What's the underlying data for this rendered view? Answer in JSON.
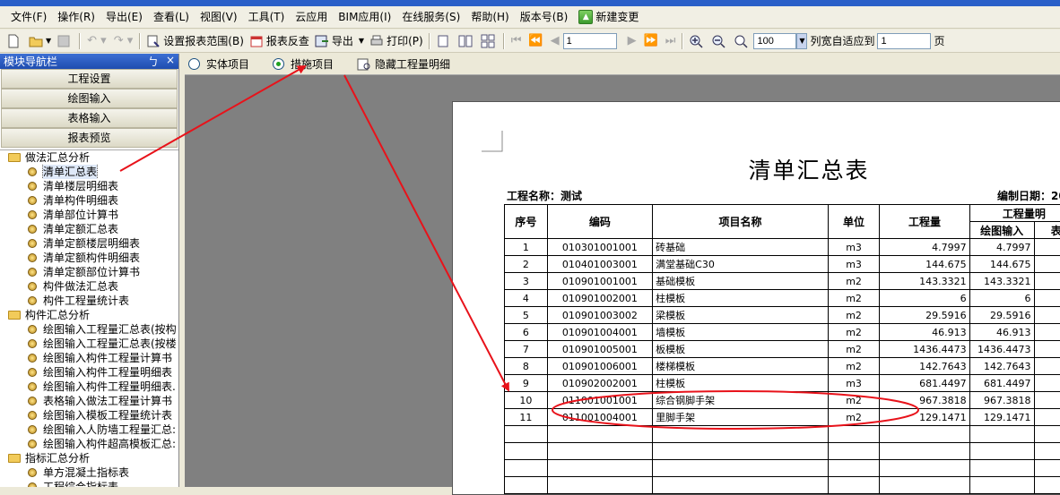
{
  "menu": [
    "文件(F)",
    "操作(R)",
    "导出(E)",
    "查看(L)",
    "视图(V)",
    "工具(T)",
    "云应用",
    "BIM应用(I)",
    "在线服务(S)",
    "帮助(H)",
    "版本号(B)"
  ],
  "menu_extra": "新建变更",
  "toolbar": {
    "set_range": "设置报表范围(B)",
    "check": "报表反查",
    "export": "导出",
    "print": "打印(P)",
    "page": "1",
    "zoom": "100",
    "fit": "列宽自适应到",
    "fit_value": "1",
    "fit_unit": "页"
  },
  "nav": {
    "title": "模块导航栏",
    "pin": "ㄅ",
    "close": "×",
    "buttons": [
      "工程设置",
      "绘图输入",
      "表格输入",
      "报表预览"
    ],
    "tree": [
      {
        "type": "folder",
        "label": "做法汇总分析"
      },
      {
        "type": "leaf",
        "label": "清单汇总表",
        "selected": true
      },
      {
        "type": "leaf",
        "label": "清单楼层明细表"
      },
      {
        "type": "leaf",
        "label": "清单构件明细表"
      },
      {
        "type": "leaf",
        "label": "清单部位计算书"
      },
      {
        "type": "leaf",
        "label": "清单定额汇总表"
      },
      {
        "type": "leaf",
        "label": "清单定额楼层明细表"
      },
      {
        "type": "leaf",
        "label": "清单定额构件明细表"
      },
      {
        "type": "leaf",
        "label": "清单定额部位计算书"
      },
      {
        "type": "leaf",
        "label": "构件做法汇总表"
      },
      {
        "type": "leaf",
        "label": "构件工程量统计表"
      },
      {
        "type": "folder",
        "label": "构件汇总分析"
      },
      {
        "type": "leaf",
        "label": "绘图输入工程量汇总表(按构"
      },
      {
        "type": "leaf",
        "label": "绘图输入工程量汇总表(按楼"
      },
      {
        "type": "leaf",
        "label": "绘图输入构件工程量计算书"
      },
      {
        "type": "leaf",
        "label": "绘图输入构件工程量明细表"
      },
      {
        "type": "leaf",
        "label": "绘图输入构件工程量明细表."
      },
      {
        "type": "leaf",
        "label": "表格输入做法工程量计算书"
      },
      {
        "type": "leaf",
        "label": "绘图输入模板工程量统计表"
      },
      {
        "type": "leaf",
        "label": "绘图输入人防墙工程量汇总:"
      },
      {
        "type": "leaf",
        "label": "绘图输入构件超高模板汇总:"
      },
      {
        "type": "folder",
        "label": "指标汇总分析"
      },
      {
        "type": "leaf",
        "label": "单方混凝土指标表"
      },
      {
        "type": "leaf",
        "label": "工程综合指标表"
      }
    ]
  },
  "radio": [
    {
      "label": "实体项目",
      "checked": false
    },
    {
      "label": "措施项目",
      "checked": true
    },
    {
      "label": "隐藏工程量明细",
      "checked": false
    }
  ],
  "report": {
    "title": "清单汇总表",
    "project": "工程名称：测试",
    "date": "编制日期：20",
    "headers": [
      "序号",
      "编码",
      "项目名称",
      "单位",
      "工程量",
      "工程量明",
      "绘图输入",
      "表"
    ],
    "rows": [
      [
        "1",
        "010301001001",
        "砖基础",
        "m3",
        "4.7997",
        "4.7997"
      ],
      [
        "2",
        "010401003001",
        "满堂基础C30",
        "m3",
        "144.675",
        "144.675"
      ],
      [
        "3",
        "010901001001",
        "基础模板",
        "m2",
        "143.3321",
        "143.3321"
      ],
      [
        "4",
        "010901002001",
        "柱模板",
        "m2",
        "6",
        "6"
      ],
      [
        "5",
        "010901003002",
        "梁模板",
        "m2",
        "29.5916",
        "29.5916"
      ],
      [
        "6",
        "010901004001",
        "墙模板",
        "m2",
        "46.913",
        "46.913"
      ],
      [
        "7",
        "010901005001",
        "板模板",
        "m2",
        "1436.4473",
        "1436.4473"
      ],
      [
        "8",
        "010901006001",
        "楼梯模板",
        "m2",
        "142.7643",
        "142.7643"
      ],
      [
        "9",
        "010902002001",
        "柱模板",
        "m3",
        "681.4497",
        "681.4497"
      ],
      [
        "10",
        "011001001001",
        "综合钢脚手架",
        "m2",
        "967.3818",
        "967.3818"
      ],
      [
        "11",
        "011001004001",
        "里脚手架",
        "m2",
        "129.1471",
        "129.1471"
      ]
    ],
    "empty_rows": 4
  },
  "annotation_color": "#e8121a"
}
